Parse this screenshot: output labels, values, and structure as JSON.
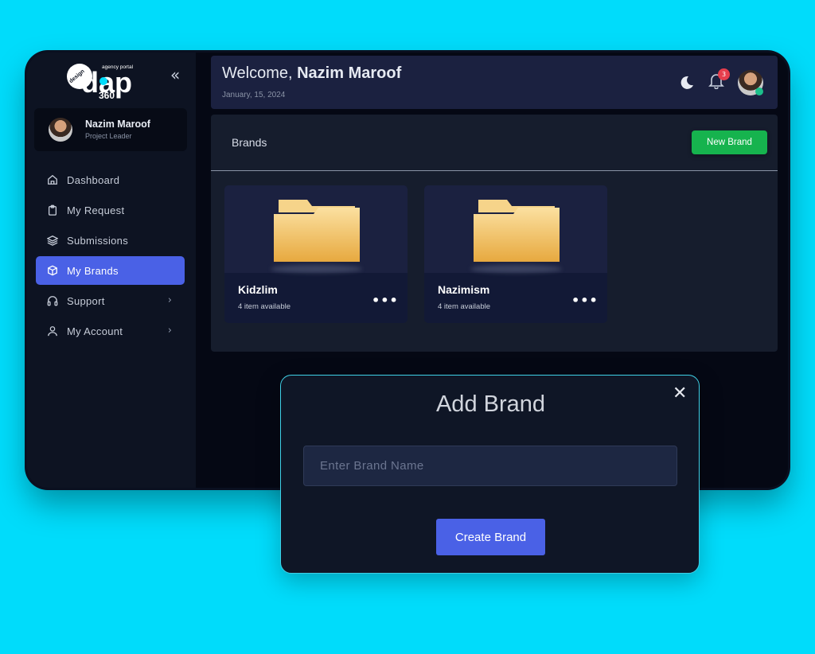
{
  "app": {
    "logo_main": "dap",
    "logo_design": "design",
    "logo_portal": "agency portal",
    "logo_num": "360",
    "collapse_glyph": "«"
  },
  "user": {
    "name": "Nazim Maroof",
    "role": "Project Leader"
  },
  "sidebar": {
    "items": [
      {
        "label": "Dashboard",
        "icon": "home-icon",
        "active": false,
        "has_chevron": false
      },
      {
        "label": "My Request",
        "icon": "clipboard-icon",
        "active": false,
        "has_chevron": false
      },
      {
        "label": "Submissions",
        "icon": "layers-icon",
        "active": false,
        "has_chevron": false
      },
      {
        "label": "My Brands",
        "icon": "cube-icon",
        "active": true,
        "has_chevron": false
      },
      {
        "label": "Support",
        "icon": "headphones-icon",
        "active": false,
        "has_chevron": true
      },
      {
        "label": "My Account",
        "icon": "user-icon",
        "active": false,
        "has_chevron": true
      }
    ],
    "chevron_glyph": "›"
  },
  "header": {
    "welcome_prefix": "Welcome, ",
    "welcome_name": "Nazim Maroof",
    "date": "January, 15, 2024",
    "notification_count": "3"
  },
  "brands_panel": {
    "title": "Brands",
    "new_button_label": "New Brand",
    "cards": [
      {
        "name": "Kidzlim",
        "count": "4 item available"
      },
      {
        "name": "Nazimism",
        "count": "4 item available"
      }
    ],
    "more_glyph": "•••"
  },
  "modal": {
    "title": "Add Brand",
    "close_glyph": "✕",
    "input_placeholder": "Enter Brand Name",
    "input_value": "",
    "submit_label": "Create Brand"
  },
  "colors": {
    "background": "#00dcfb",
    "accent": "#4a61e6",
    "success": "#16b34e",
    "badge": "#e53e4d",
    "folder": "#f3c56b"
  }
}
